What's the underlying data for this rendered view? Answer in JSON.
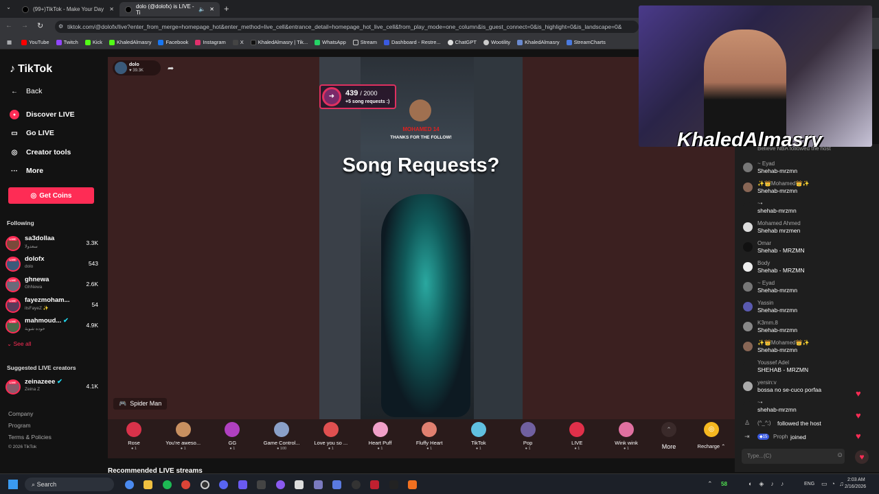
{
  "browser": {
    "tabs": [
      {
        "title": "(99+)TikTok - Make Your Day"
      },
      {
        "title": "dolo (@dolofx) is LIVE - Ti"
      }
    ],
    "url": "tiktok.com/@dolofx/live?enter_from_merge=homepage_hot&enter_method=live_cell&entrance_detail=homepage_hot_live_cell&from_play_mode=one_column&is_guest_connect=0&is_highlight=0&is_landscape=0&",
    "bookmarks": [
      "YouTube",
      "Twitch",
      "Kick",
      "KhaledAlmasry",
      "Facebook",
      "Instagram",
      "X",
      "KhaledAlmasry | Tik...",
      "WhatsApp",
      "Stream",
      "Dashboard - Restre...",
      "ChatGPT",
      "Wootility",
      "KhaledAlmasry",
      "StreamCharts"
    ]
  },
  "sidebar": {
    "logo": "TikTok",
    "nav": [
      {
        "label": "Back",
        "icon": "back-arrow-icon"
      },
      {
        "label": "Discover LIVE",
        "icon": "live-icon"
      },
      {
        "label": "Go LIVE",
        "icon": "camera-icon"
      },
      {
        "label": "Creator tools",
        "icon": "lightbulb-icon"
      },
      {
        "label": "More",
        "icon": "more-icon"
      }
    ],
    "get_coins": "Get Coins",
    "following_label": "Following",
    "following": [
      {
        "name": "sa3dollaa",
        "sub": "سعدولا",
        "count": "3.3K",
        "color": "#7a4a3a"
      },
      {
        "name": "dolofx",
        "sub": "dolo",
        "count": "543",
        "color": "#3a5a7a"
      },
      {
        "name": "ghnewa",
        "sub": "GhNewa",
        "count": "2.6K",
        "color": "#6a6a7a"
      },
      {
        "name": "fayezmoham...",
        "sub": "itsFayeZ ✨",
        "count": "54",
        "color": "#5a3a5a"
      },
      {
        "name": "mahmoud...",
        "sub": "حوده شوبة",
        "count": "4.9K",
        "color": "#4a6a4a"
      }
    ],
    "see_all": "See all",
    "suggested_label": "Suggested LIVE creators",
    "suggested": [
      {
        "name": "zeinazeee",
        "sub": "Zeina Z",
        "count": "4.1K",
        "color": "#8a5a6a"
      }
    ],
    "footer": [
      "Company",
      "Program",
      "Terms & Policies"
    ],
    "copyright": "© 2026 TikTok"
  },
  "stream": {
    "host_name": "dolo",
    "host_likes": "39.3K",
    "progress_text": "439",
    "progress_total": "/ 2000",
    "progress_fraction": 0.2195,
    "progress_subtitle": "+5 song requests :)",
    "follow_name": "MOHAMED 14",
    "follow_thanks": "THANKS FOR THE FOLLOW!",
    "headline": "Song Requests?",
    "game_label": "Spider Man"
  },
  "gifts": [
    {
      "name": "Rose",
      "price": "1",
      "color": "#d8324a"
    },
    {
      "name": "You're aweso...",
      "price": "1",
      "color": "#c89060"
    },
    {
      "name": "GG",
      "price": "1",
      "color": "#b040c0"
    },
    {
      "name": "Game Control...",
      "price": "100",
      "color": "#8aa0c8"
    },
    {
      "name": "Love you so ...",
      "price": "1",
      "color": "#e05050"
    },
    {
      "name": "Heart Puff",
      "price": "1",
      "color": "#f0a0c8"
    },
    {
      "name": "Fluffy Heart",
      "price": "1",
      "color": "#e08070"
    },
    {
      "name": "TikTok",
      "price": "1",
      "color": "#60c0e0"
    },
    {
      "name": "Pop",
      "price": "1",
      "color": "#7060a0"
    },
    {
      "name": "LIVE",
      "price": "1",
      "color": "#e0304a"
    },
    {
      "name": "Wink wink",
      "price": "1",
      "color": "#e070a0"
    }
  ],
  "gift_more": "More",
  "recharge": "Recharge",
  "recommended": "Recommended LIVE streams",
  "webcam": {
    "overlay_name": "KhaledAlmasry"
  },
  "chat": {
    "top_line": "Believe NBA  followed the host",
    "messages": [
      {
        "name": "~ Eyad",
        "text": "Shehab-mrzmn",
        "color": "#777"
      },
      {
        "name": "✨👑Mohamed👑✨",
        "text": "Shehab-mrzmn",
        "color": "#886655"
      },
      {
        "name": "~•",
        "text": "shehab-mrzmn",
        "color": "#1e1e1e"
      },
      {
        "name": "Mohamed Ahmed",
        "text": "Shehab mrzmen",
        "color": "#ddd"
      },
      {
        "name": "Omar",
        "text": "Shehab - MRZMN",
        "color": "#111"
      },
      {
        "name": "Body",
        "text": "Shehab - MRZMN",
        "color": "#eee"
      },
      {
        "name": "~ Eyad",
        "text": "Shehab-mrzmn",
        "color": "#777"
      },
      {
        "name": "Yassin",
        "text": "Shehab-mrzmn",
        "color": "#5a5ab0"
      },
      {
        "name": "K3mm.8",
        "text": "Shehab-mrzmn",
        "color": "#888"
      },
      {
        "name": "✨👑Mohamed👑✨",
        "text": "Shehab-mrzmn",
        "color": "#886655"
      },
      {
        "name": "Youssef Adel",
        "text": "SHEHAB - MRZMN",
        "color": "#1e1e1e"
      },
      {
        "name": "yersin:v",
        "text": "bossa no se-cuco porfaa",
        "color": "#aaa"
      },
      {
        "name": "~•",
        "text": "shehab-mrzmn",
        "color": "#1e1e1e"
      }
    ],
    "follow_event": {
      "name": "(^_^;)",
      "text": "followed the host"
    },
    "join_event": {
      "level": "15",
      "name": "Proph",
      "text": "joined"
    },
    "input_placeholder": "Type...(C)"
  },
  "taskbar": {
    "search": "Search",
    "tray_count": "58",
    "lang": "ENG",
    "time": "2:03 AM",
    "date": "2/16/2026"
  }
}
